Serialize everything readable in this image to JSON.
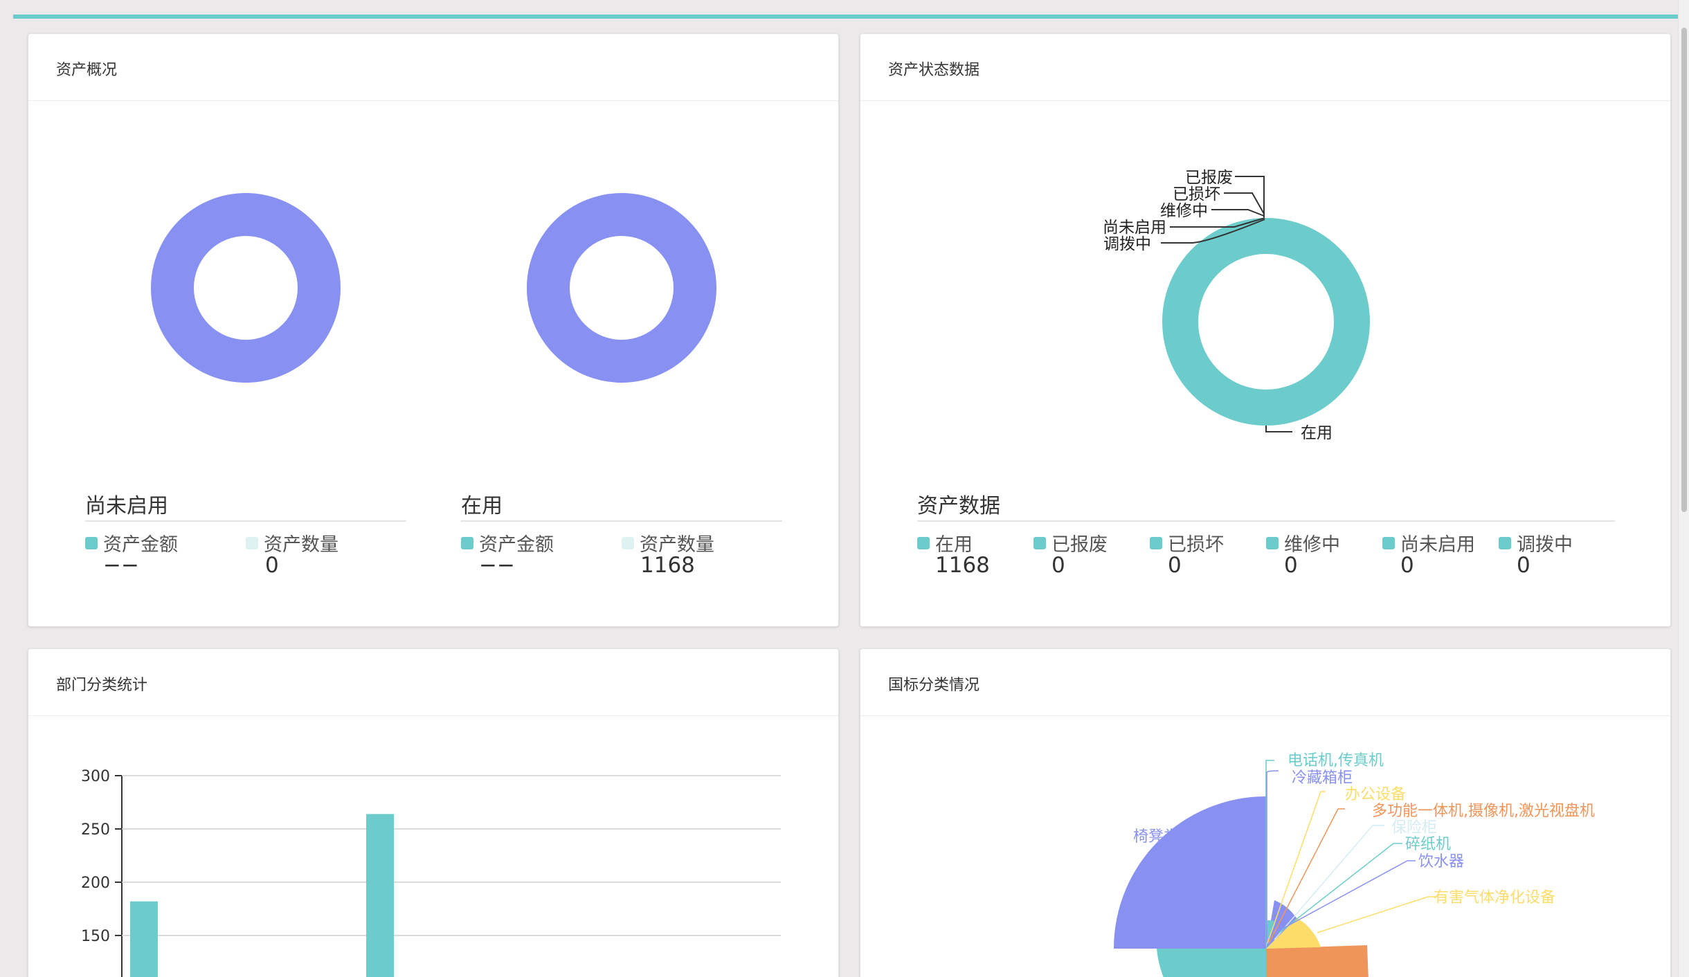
{
  "colors": {
    "accent": "#6bcccb",
    "purple": "#8891f2",
    "light": "#dff2f2",
    "yellow": "#fcdd6a",
    "orange": "#f0955a",
    "paleblue": "#d4ecf4"
  },
  "overview": {
    "title": "资产概况",
    "groups": [
      {
        "label": "尚未启用",
        "amount_label": "资产金额",
        "amount_value": "−−",
        "count_label": "资产数量",
        "count_value": "0"
      },
      {
        "label": "在用",
        "amount_label": "资产金额",
        "amount_value": "−−",
        "count_label": "资产数量",
        "count_value": "1168"
      }
    ]
  },
  "status": {
    "title": "资产状态数据",
    "summary_title": "资产数据",
    "items": [
      {
        "label": "在用",
        "value": "1168"
      },
      {
        "label": "已报废",
        "value": "0"
      },
      {
        "label": "已损坏",
        "value": "0"
      },
      {
        "label": "维修中",
        "value": "0"
      },
      {
        "label": "尚未启用",
        "value": "0"
      },
      {
        "label": "调拨中",
        "value": "0"
      }
    ]
  },
  "dept": {
    "title": "部门分类统计"
  },
  "gb": {
    "title": "国标分类情况"
  },
  "chart_data": [
    {
      "type": "pie",
      "name": "资产状态数据",
      "labels": [
        "在用",
        "已报废",
        "已损坏",
        "维修中",
        "尚未启用",
        "调拨中"
      ],
      "values": [
        1168,
        0,
        0,
        0,
        0,
        0
      ]
    },
    {
      "type": "bar",
      "name": "部门分类统计",
      "yticks": [
        150,
        200,
        250,
        300
      ],
      "values": [
        182,
        264
      ]
    },
    {
      "type": "pie",
      "name": "国标分类情况",
      "labels": [
        "椅凳类",
        "电话机,传真机",
        "冷藏箱柜",
        "办公设备",
        "多功能一体机,摄像机,激光视盘机",
        "保险柜",
        "碎纸机",
        "饮水器",
        "有害气体净化设备"
      ]
    }
  ]
}
